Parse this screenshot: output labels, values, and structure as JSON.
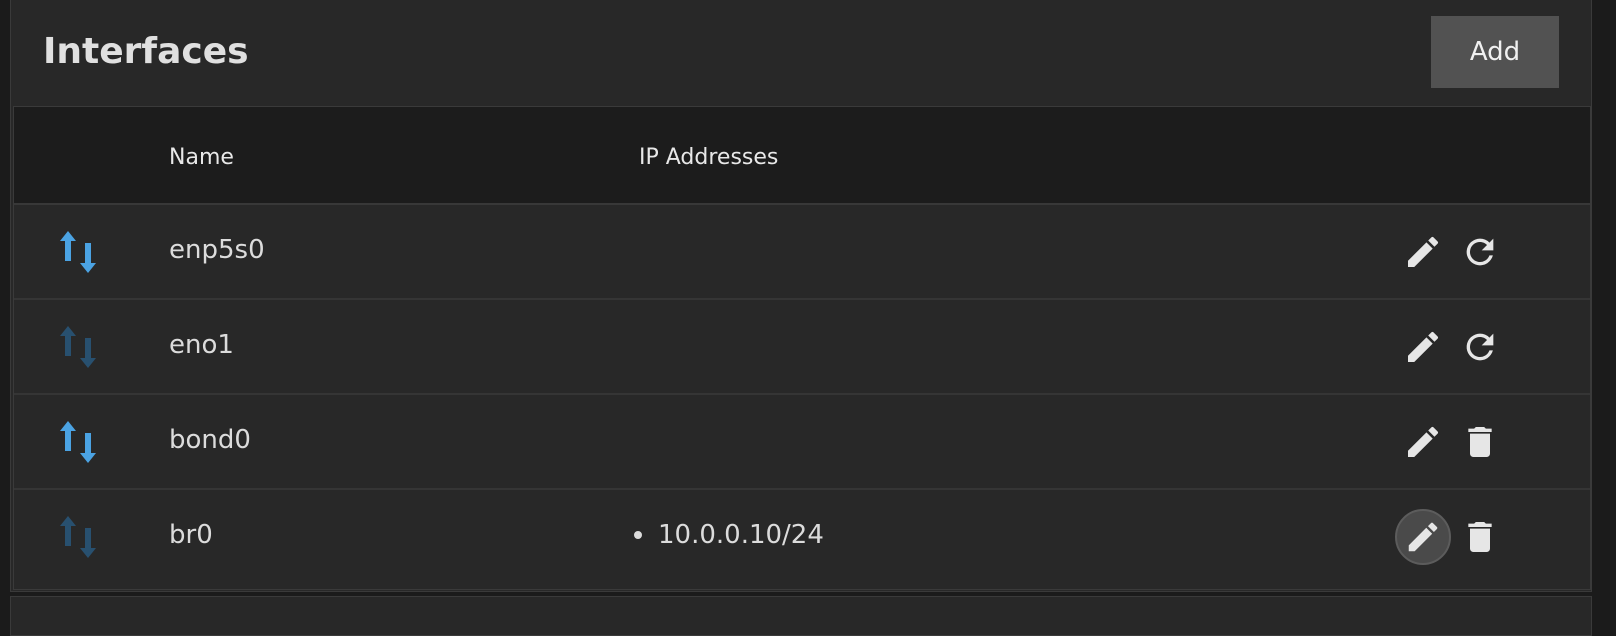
{
  "card": {
    "title": "Interfaces",
    "add_label": "Add"
  },
  "table": {
    "columns": [
      "",
      "Name",
      "IP Addresses",
      ""
    ],
    "rows": [
      {
        "name": "enp5s0",
        "ips": [],
        "link_state": "up",
        "actions": [
          "edit",
          "reset"
        ]
      },
      {
        "name": "eno1",
        "ips": [],
        "link_state": "down",
        "actions": [
          "edit",
          "reset"
        ]
      },
      {
        "name": "bond0",
        "ips": [],
        "link_state": "up",
        "actions": [
          "edit",
          "delete"
        ]
      },
      {
        "name": "br0",
        "ips": [
          "10.0.0.10/24"
        ],
        "link_state": "down",
        "actions": [
          "edit",
          "delete"
        ]
      }
    ]
  },
  "icons": {
    "status": "arrows-up-down-icon",
    "edit": "pencil-icon",
    "reset": "refresh-icon",
    "delete": "trash-icon"
  },
  "colors": {
    "page_bg": "#1b1b1b",
    "card_bg": "#282828",
    "header_bg": "#1c1c1c",
    "link_up": "#4ba3e3",
    "link_down": "#28506f",
    "button_bg": "#525252",
    "text": "#dcdcdc"
  }
}
